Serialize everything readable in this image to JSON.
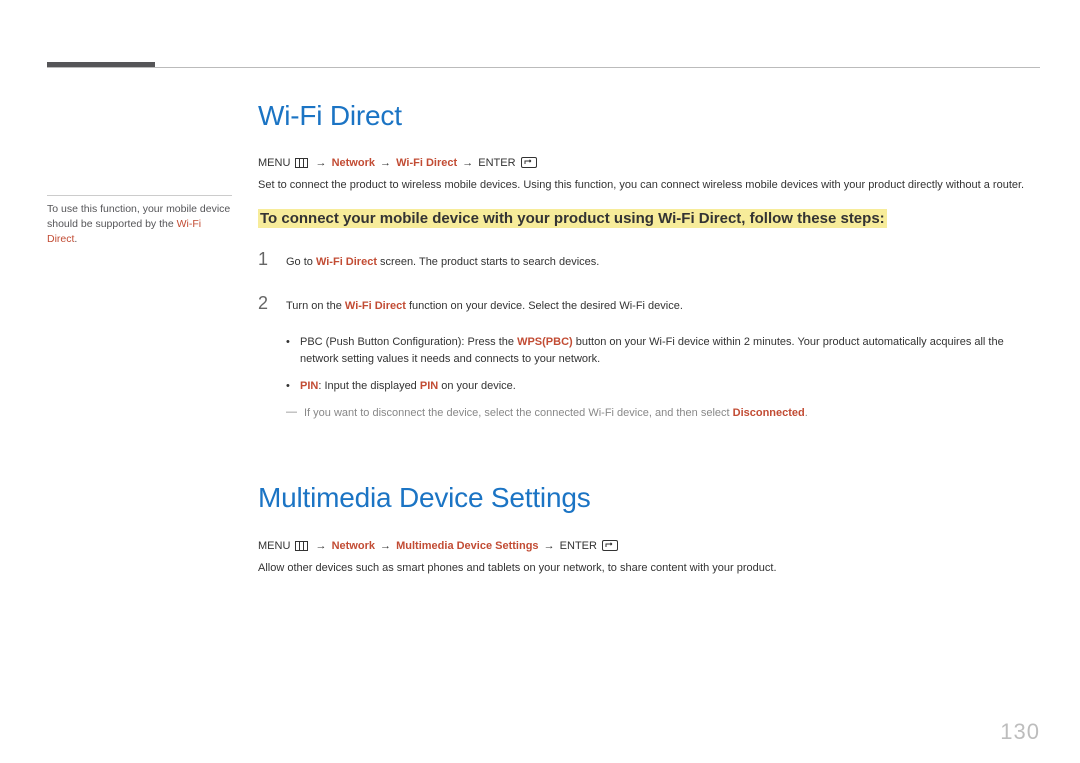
{
  "page_number": "130",
  "sidebar_note": {
    "prefix": "To use this function, your mobile device should be supported by the ",
    "accent": "Wi-Fi Direct",
    "suffix": "."
  },
  "sections": [
    {
      "title": "Wi-Fi Direct",
      "nav": {
        "menu": "MENU",
        "arrow": "→",
        "network": "Network",
        "item": "Wi-Fi Direct",
        "enter": "ENTER"
      },
      "desc": "Set to connect the product to wireless mobile devices. Using this function, you can connect wireless mobile devices with your product directly without a router.",
      "highlight": "To connect your mobile device with your product using Wi-Fi Direct, follow these steps:",
      "steps": [
        {
          "num": "1",
          "pre": "Go to ",
          "accent": "Wi-Fi Direct",
          "post": " screen. The product starts to search devices."
        },
        {
          "num": "2",
          "pre": "Turn on the ",
          "accent": "Wi-Fi Direct",
          "post": " function on your device. Select the desired Wi-Fi device."
        }
      ],
      "bullets": [
        {
          "pre": "PBC (Push Button Configuration): Press the ",
          "accent": "WPS(PBC)",
          "post": " button on your Wi-Fi device within 2 minutes. Your product automatically acquires all the network setting values it needs and connects to your network."
        },
        {
          "accent1": "PIN",
          "mid": ": Input the displayed ",
          "accent2": "PIN",
          "post": " on your device."
        }
      ],
      "footnote": {
        "pre": "If you want to disconnect the device, select the connected Wi-Fi device, and then select ",
        "accent": "Disconnected",
        "post": "."
      }
    },
    {
      "title": "Multimedia Device Settings",
      "nav": {
        "menu": "MENU",
        "arrow": "→",
        "network": "Network",
        "item": "Multimedia Device Settings",
        "enter": "ENTER"
      },
      "desc": "Allow other devices such as smart phones and tablets on your network, to share content with your product."
    }
  ]
}
